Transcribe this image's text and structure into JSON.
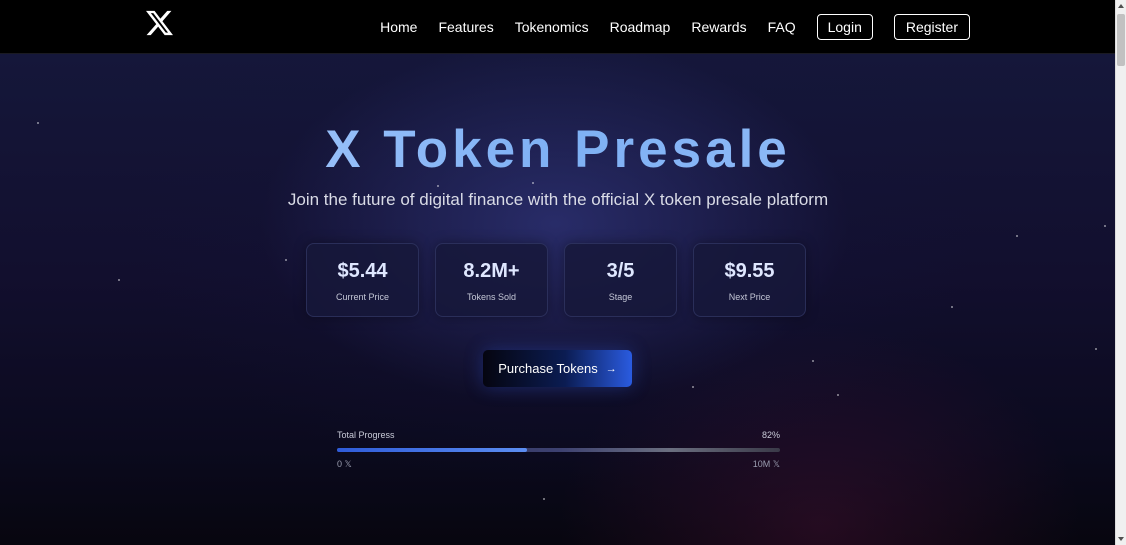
{
  "nav": {
    "logo_icon": "x-logo-icon",
    "links": [
      "Home",
      "Features",
      "Tokenomics",
      "Roadmap",
      "Rewards",
      "FAQ"
    ],
    "login_label": "Login",
    "register_label": "Register"
  },
  "hero": {
    "title": "X Token Presale",
    "subtitle": "Join the future of digital finance with the official X token presale platform"
  },
  "stats": [
    {
      "value": "$5.44",
      "label": "Current Price"
    },
    {
      "value": "8.2M+",
      "label": "Tokens Sold"
    },
    {
      "value": "3/5",
      "label": "Stage"
    },
    {
      "value": "$9.55",
      "label": "Next Price"
    }
  ],
  "cta": {
    "label": "Purchase Tokens",
    "icon": "arrow-right-icon"
  },
  "progress": {
    "label": "Total Progress",
    "percent_text": "82%",
    "fill_fraction": 0.43,
    "min_label": "0 𝕏",
    "max_label": "10M 𝕏"
  },
  "colors": {
    "title_gradient_start": "#b7d3ff",
    "title_gradient_end": "#7eb0f4",
    "cta_gradient_end": "#2a5be0",
    "progress_fill": "#2f5bd8"
  }
}
